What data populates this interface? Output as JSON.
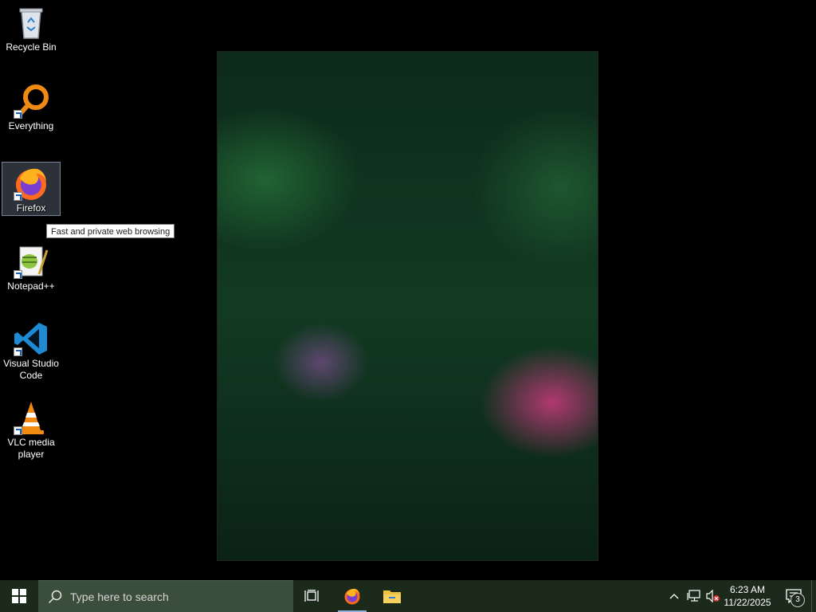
{
  "desktop": {
    "icons": [
      {
        "label": "Recycle Bin",
        "icon": "recycle-bin-icon"
      },
      {
        "label": "Everything",
        "icon": "everything-search-icon"
      },
      {
        "label": "Firefox",
        "icon": "firefox-icon",
        "selected": true
      },
      {
        "label": "Notepad++",
        "icon": "notepad-plus-plus-icon"
      },
      {
        "label": "Visual Studio Code",
        "icon": "vscode-icon"
      },
      {
        "label": "VLC media player",
        "icon": "vlc-icon"
      }
    ],
    "tooltip": "Fast and private web browsing"
  },
  "taskbar": {
    "search_placeholder": "Type here to search",
    "pinned": [
      "firefox-icon",
      "file-explorer-icon"
    ],
    "tray": {
      "time": "6:23 AM",
      "date": "11/22/2025",
      "notification_count": "3",
      "volume_muted": true
    }
  },
  "colors": {
    "taskbar": "#1c2a1c",
    "search_box": "#3b4d3b",
    "accent": "#8fb0d8"
  }
}
